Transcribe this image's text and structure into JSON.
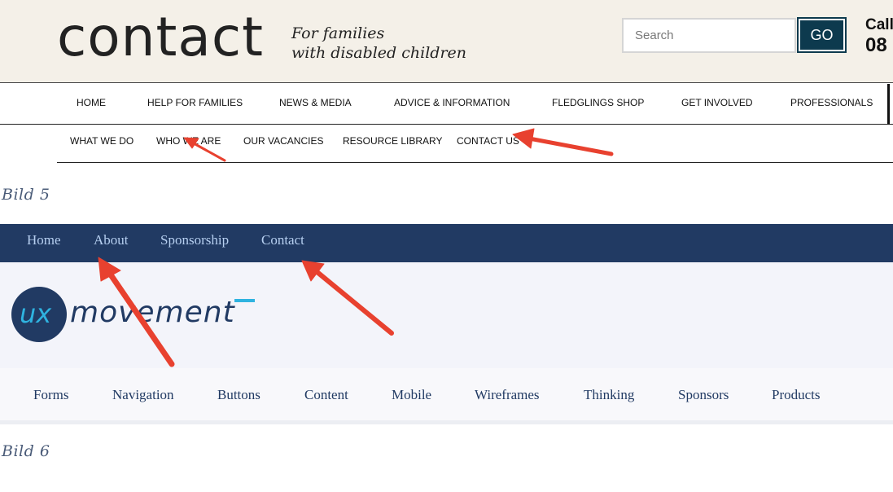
{
  "contact": {
    "logo_word": "contact",
    "tagline_line1": "For families",
    "tagline_line2": "with disabled children",
    "search": {
      "placeholder": "Search",
      "button": "GO"
    },
    "call_label": "Call",
    "call_number": "08",
    "main_nav": [
      "HOME",
      "HELP FOR FAMILIES",
      "NEWS & MEDIA",
      "ADVICE & INFORMATION",
      "FLEDGLINGS SHOP",
      "GET INVOLVED",
      "PROFESSIONALS"
    ],
    "sub_nav": [
      "WHAT WE DO",
      "WHO WE ARE",
      "OUR VACANCIES",
      "RESOURCE LIBRARY",
      "CONTACT US"
    ]
  },
  "caption_5": "Bild  5",
  "uxmovement": {
    "top_nav": [
      "Home",
      "About",
      "Sponsorship",
      "Contact"
    ],
    "logo_ux": "ux",
    "logo_word": "movement",
    "categories": [
      "Forms",
      "Navigation",
      "Buttons",
      "Content",
      "Mobile",
      "Wireframes",
      "Thinking",
      "Sponsors",
      "Products"
    ]
  },
  "caption_6": "Bild  6",
  "colors": {
    "contact_bg": "#f4f0e8",
    "go_button": "#0d3a4e",
    "ux_navy": "#213a63",
    "ux_cyan": "#2fb3e0",
    "annotation_arrow": "#e8412f"
  }
}
